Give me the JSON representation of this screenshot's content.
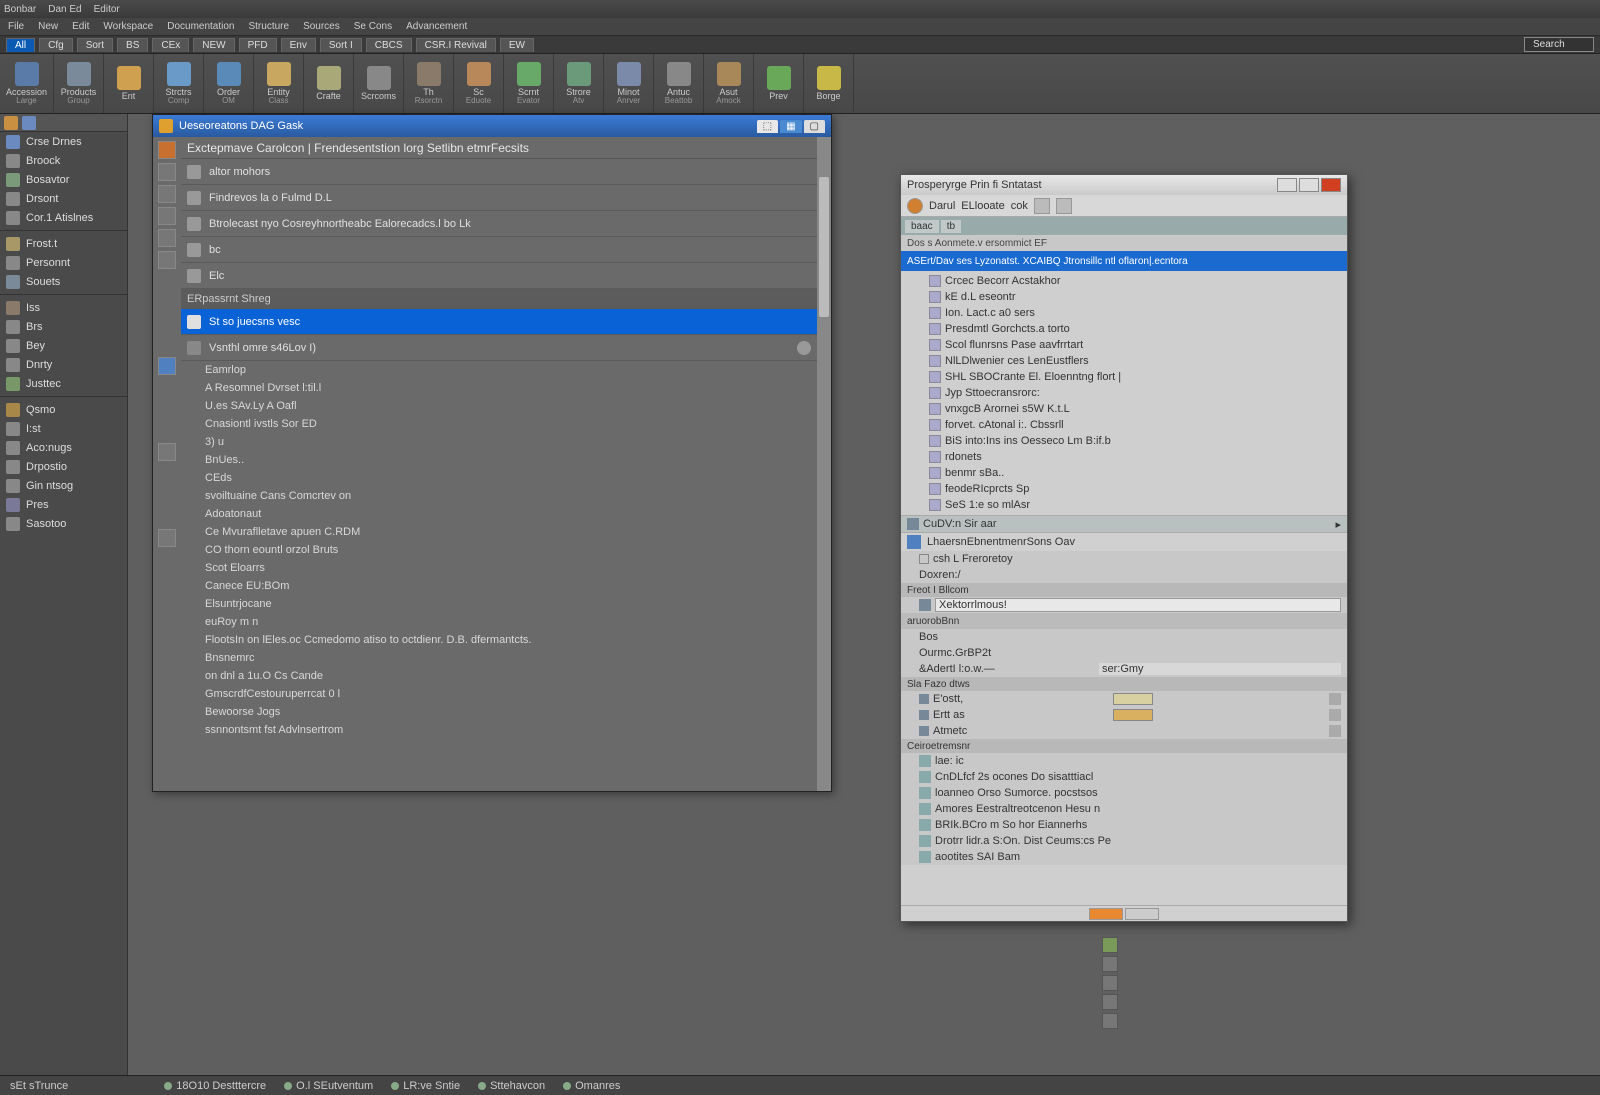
{
  "titlebar": {
    "app": "Bonbar",
    "doc": "Dan Ed",
    "mode": "Editor"
  },
  "menu": [
    "File",
    "New",
    "Edit",
    "Workspace",
    "Documentation",
    "Structure",
    "Sources",
    "Se Cons",
    "Advancement"
  ],
  "tabs": {
    "items": [
      "All",
      "Cfg",
      "Sort",
      "BS",
      "CEx",
      "NEW",
      "PFD",
      "Env",
      "Sort I",
      "CBCS",
      "CSR.I Revival",
      "EW"
    ],
    "active": 0,
    "search_placeholder": "Search"
  },
  "ribbon": [
    {
      "label": "Accession",
      "sub": "Large",
      "color": "#5a7aa8"
    },
    {
      "label": "Products",
      "sub": "Group",
      "color": "#7a8a9a"
    },
    {
      "label": "Ent",
      "sub": "",
      "color": "#cfa050"
    },
    {
      "label": "Strctrs",
      "sub": "Comp",
      "color": "#6a9ac8"
    },
    {
      "label": "Order",
      "sub": "OM",
      "color": "#5a8ab8"
    },
    {
      "label": "Entity",
      "sub": "Class",
      "color": "#c8a860"
    },
    {
      "label": "Crafte",
      "sub": "",
      "color": "#a8a878"
    },
    {
      "label": "Scrcoms",
      "sub": "",
      "color": "#888"
    },
    {
      "label": "Th",
      "sub": "Rsorctn",
      "color": "#8a7a6a"
    },
    {
      "label": "Sc",
      "sub": "Eduote",
      "color": "#b8885a"
    },
    {
      "label": "Scrnt",
      "sub": "Evator",
      "color": "#68a868"
    },
    {
      "label": "Strore",
      "sub": "Atv",
      "color": "#6a9a7a"
    },
    {
      "label": "Minot",
      "sub": "Anrver",
      "color": "#7a8aa8"
    },
    {
      "label": "Antuc",
      "sub": "Beattob",
      "color": "#888"
    },
    {
      "label": "Asut",
      "sub": "Amock",
      "color": "#a88858"
    },
    {
      "label": "Prev",
      "sub": "",
      "color": "#68a858"
    },
    {
      "label": "Borge",
      "sub": "",
      "color": "#c8b848"
    }
  ],
  "leftbar": {
    "groups": [
      {
        "items": [
          {
            "label": "Crse Drnes",
            "color": "#6a8ac0"
          },
          {
            "label": "Broock",
            "color": "#888"
          },
          {
            "label": "Bosavtor",
            "color": "#7a9a7a"
          },
          {
            "label": "Drsont",
            "color": "#888"
          },
          {
            "label": "Cor.1 Atislnes",
            "color": "#888"
          }
        ]
      },
      {
        "items": [
          {
            "label": "Frost.t",
            "color": "#a89868"
          },
          {
            "label": "Personnt",
            "color": "#888"
          },
          {
            "label": "Souets",
            "color": "#7a8a98"
          }
        ]
      },
      {
        "items": [
          {
            "label": "Iss",
            "color": "#8a7a6a"
          },
          {
            "label": "Brs",
            "color": "#888"
          },
          {
            "label": "Bey",
            "color": "#888"
          },
          {
            "label": "Dnrty",
            "color": "#888"
          },
          {
            "label": "Justtec",
            "color": "#789868"
          }
        ]
      },
      {
        "items": [
          {
            "label": "Qsmo",
            "color": "#a88848"
          },
          {
            "label": "I:st",
            "color": "#888"
          },
          {
            "label": "Aco:nugs",
            "color": "#888"
          },
          {
            "label": "Drpostio",
            "color": "#888"
          },
          {
            "label": "Gin ntsog",
            "color": "#888"
          },
          {
            "label": "Pres",
            "color": "#7a7a98"
          },
          {
            "label": "Sasotoo",
            "color": "#888"
          }
        ]
      }
    ]
  },
  "browser": {
    "title": "Ueseoreatons  DAG Gask",
    "header": "Exctepmave Carolcon  |  Frendesentstion lorg  Setlibn etmrFecsits",
    "items": [
      "altor mohors",
      "Findrevos la o Fulmd D.L",
      "Btrolecast nyo Cosreyhnortheabc Ealorecadcs.l bo Lk",
      "bc",
      "Elc"
    ],
    "section": "ERpassrnt Shreg",
    "selected": "St so juecsns vesc",
    "detail": {
      "title": "Vsnthl omre s46Lov I)",
      "rows": [
        "Eamrlop",
        "A Resomnel Dvrset l:til.l",
        "U.es SAv.Ly    A Oafl",
        "Cnasiontl ivstls  Sor ED",
        "3)  u",
        "BnUes..",
        "CEds",
        "svoiltuaine Cans Comcrtev on",
        "Adoatonaut",
        "Ce Mvuraflletave apuen C.RDM",
        "CO thorn eountl orzol Bruts",
        "Scot Eloarrs",
        "Canece  EU:BOm",
        "Elsuntrjocane",
        "euRoy m n",
        "FlootsIn on lEles.oc Ccmedomo atiso to octdienr.  D.B.  dfermantcts.",
        "Bnsnemrc",
        "on dnl a 1u.O  Cs  Cande",
        "GmscrdfCestouruperrcat 0 l",
        "Bewoorse Jogs",
        "ssnnontsmt fst Advlnsertrom"
      ]
    }
  },
  "dialog": {
    "title": "Prosperyrge  Prin fi Sntatast",
    "toolbar": [
      "Darul",
      "ELlooate",
      "cok"
    ],
    "tabs": [
      "baac",
      "tb"
    ],
    "path": "Dos s         Aonmete.v  ersommict EF",
    "selection": "ASErt/Dav ses Lyzonatst.   XCAIBQ Jtronsillc ntl oflaron|.ecntora",
    "tree": [
      "Crcec  Becorr   Acstakhor",
      "kE d.L eseontr",
      "Ion. Lact.c a0 sers",
      "Presdmtl Gorchcts.a torto",
      "Scol flunrsns Pase aavfrrtart",
      "NlLDlwenier ces LenEustflers",
      "SHL SBOCrante El. Eloenntng flort  |",
      "Jyp Sttoecransrorc:",
      "vnxgcB Arornei  s5W K.t.L",
      "forvet. cAtonal i:. Cbssrll",
      "BiS into:Ins  ins Oesseco              Lm  B:if.b",
      "rdonets",
      "benmr  sBa..",
      "feodeRIcprcts Sp",
      "SeS 1:e so mlAsr"
    ],
    "subtab": "CuDV:n     Sir aar",
    "props": {
      "header": "LhaersnEbnentmenrSons  Oav",
      "root": "csh  L Freroretoy",
      "type": "Doxren:/",
      "input_label": "Xektorrlmous!",
      "input_value": "aruorobBnn",
      "section1": "Freot I Bllcom",
      "rows1": [
        {
          "k": "Bos",
          "v": ""
        },
        {
          "k": "Ourmc.GrBP2t",
          "v": ""
        },
        {
          "k": "&AdertI l:o.w.—",
          "v": "ser:Gmy"
        }
      ],
      "section2": "Sla  Fazo dtws",
      "rows2": [
        {
          "k": "E'ostt,",
          "v": "",
          "swatch": "#d8d0a0"
        },
        {
          "k": "Ertt as",
          "v": "",
          "swatch": "#d8b060"
        },
        {
          "k": "Atmetc",
          "v": ""
        }
      ],
      "section3": "Ceiroetremsnr",
      "rows3": [
        "lae:      ic",
        "CnDLfcf 2s ocones Do sisatttiacl",
        "loanneo Orso Sumorce. pocstsos",
        "Amores Eestraltreotcenon Hesu n",
        "BRIk.BCro m So   hor Eiannerhs",
        "Drotrr lidr.a S:On. Dist Ceums:cs Pe",
        "aootites SAI              Bam"
      ]
    }
  },
  "status": {
    "left": "sEt  sTrunce",
    "items": [
      "18O10  Destttercre",
      "O.l SEutventum",
      "LR:ve Sntie",
      "Sttehavcon",
      "Omanres"
    ]
  }
}
